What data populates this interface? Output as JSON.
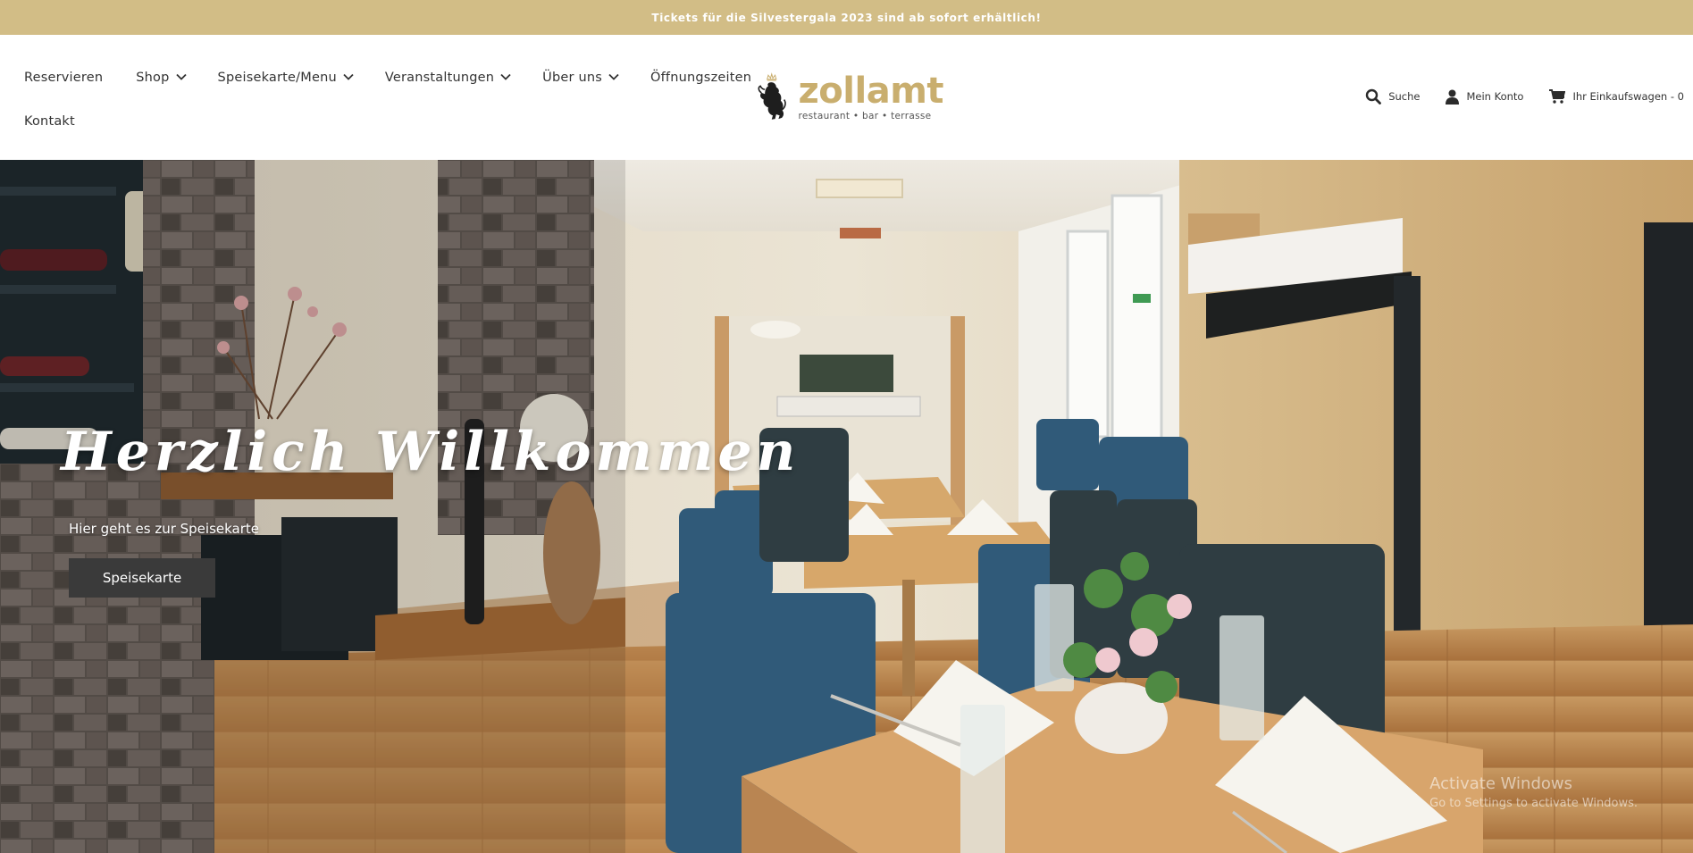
{
  "announcement": "Tickets für die Silvestergala 2023 sind ab sofort erhältlich!",
  "nav": {
    "row1": [
      {
        "label": "Reservieren",
        "dropdown": false
      },
      {
        "label": "Shop",
        "dropdown": true
      },
      {
        "label": "Speisekarte/Menu",
        "dropdown": true
      },
      {
        "label": "Veranstaltungen",
        "dropdown": true
      },
      {
        "label": "Über uns",
        "dropdown": true
      },
      {
        "label": "Öffnungszeiten",
        "dropdown": false
      }
    ],
    "row2": [
      {
        "label": "Kontakt",
        "dropdown": false
      }
    ]
  },
  "logo": {
    "word": "zollamt",
    "tagline": "restaurant • bar • terrasse"
  },
  "utils": {
    "search": "Suche",
    "account": "Mein Konto",
    "cart": "Ihr Einkaufswagen - 0"
  },
  "hero": {
    "title": "Herzlich Willkommen",
    "subtitle": "Hier geht es zur Speisekarte",
    "button": "Speisekarte"
  },
  "watermark": {
    "line1": "Activate Windows",
    "line2": "Go to Settings to activate Windows."
  },
  "colors": {
    "announcement_bg": "#d2bd86",
    "brand_gold": "#c9ae6e",
    "button_bg": "#3a3a3a"
  }
}
